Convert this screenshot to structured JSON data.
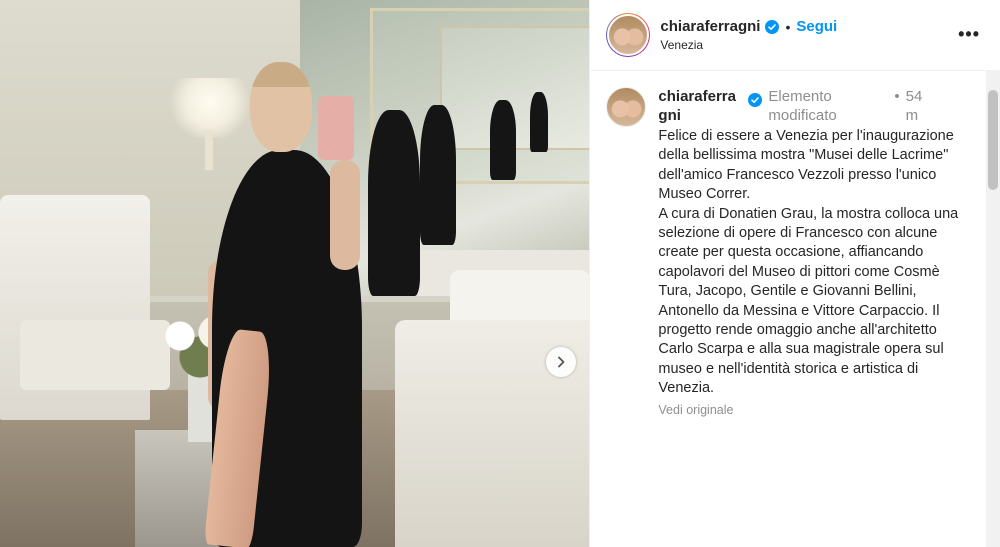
{
  "header": {
    "username": "chiaraferragni",
    "follow_label": "Segui",
    "location": "Venezia",
    "more_label": "•••"
  },
  "comment": {
    "username": "chiaraferragni",
    "edited_label": "Elemento modificato",
    "separator": "•",
    "time": "54 m",
    "paragraphs": [
      "Felice di essere a Venezia per l'inaugurazione della bellissima mostra \"Musei delle Lacrime\" dell'amico Francesco Vezzoli presso l'unico Museo Correr.",
      "A cura di Donatien Grau, la mostra colloca una selezione di opere di Francesco con alcune create per questa occasione, affiancando capolavori del Museo di pittori come Cosmè Tura, Jacopo, Gentile e Giovanni Bellini, Antonello da Messina e Vittore Carpaccio. Il progetto rende omaggio anche all'architetto Carlo Scarpa e alla sua magistrale opera sul museo e nell'identità storica e artistica di Venezia."
    ],
    "see_original": "Vedi originale"
  },
  "colors": {
    "accent": "#0095f6",
    "verified": "#0095f6",
    "muted": "#8e8e8e",
    "text": "#262626"
  },
  "icons": {
    "carousel_next": "chevron-right-icon",
    "verified": "verified-badge-icon",
    "more": "more-options-icon"
  }
}
